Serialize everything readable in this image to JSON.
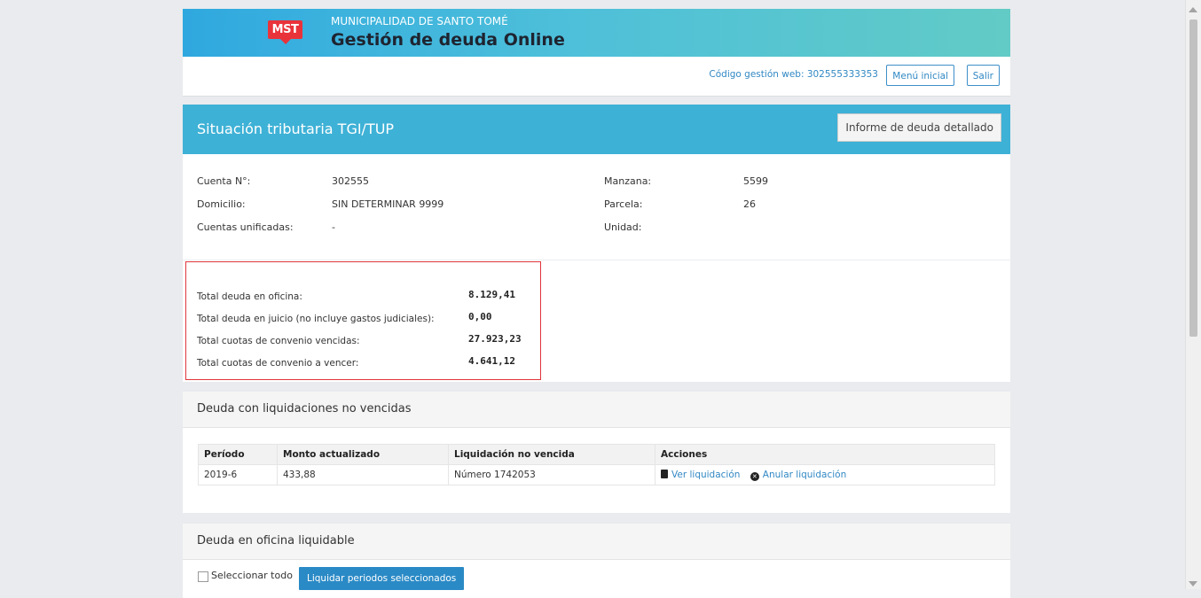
{
  "banner": {
    "logo": "MST",
    "subtitle": "MUNICIPALIDAD DE SANTO TOMÉ",
    "title": "Gestión de deuda Online"
  },
  "userbar": {
    "code_label": "Código gestión web: 302555333353",
    "menu_button": "Menú inicial",
    "logout_button": "Salir"
  },
  "situacion": {
    "title": "Situación tributaria TGI/TUP",
    "report_button": "Informe de deuda detallado"
  },
  "account": {
    "cuenta_label": "Cuenta N°:",
    "cuenta_value": "302555",
    "domicilio_label": "Domicilio:",
    "domicilio_value": "SIN DETERMINAR 9999",
    "unificadas_label": "Cuentas unificadas:",
    "unificadas_value": "-",
    "manzana_label": "Manzana:",
    "manzana_value": "5599",
    "parcela_label": "Parcela:",
    "parcela_value": "26",
    "unidad_label": "Unidad:",
    "unidad_value": ""
  },
  "totals": [
    {
      "label": "Total deuda en oficina:",
      "value": "8.129,41"
    },
    {
      "label": "Total deuda en juicio (no incluye gastos judiciales):",
      "value": "0,00"
    },
    {
      "label": "Total cuotas de convenio vencidas:",
      "value": "27.923,23"
    },
    {
      "label": "Total cuotas de convenio a vencer:",
      "value": "4.641,12"
    }
  ],
  "liquidaciones": {
    "title": "Deuda con liquidaciones no vencidas",
    "headers": [
      "Período",
      "Monto actualizado",
      "Liquidación no vencida",
      "Acciones"
    ],
    "rows": [
      {
        "periodo": "2019-6",
        "monto": "433,88",
        "liquidacion": "Número 1742053",
        "ver": "Ver liquidación",
        "anular": "Anular liquidación"
      }
    ]
  },
  "oficina": {
    "title": "Deuda en oficina liquidable",
    "select_all": "Seleccionar todo",
    "liquidar_button": "Liquidar periodos seleccionados"
  },
  "colors": {
    "accent": "#3eb1d6",
    "highlight_border": "#e0353b",
    "link": "#3188c4",
    "logo_red": "#e9333b"
  }
}
